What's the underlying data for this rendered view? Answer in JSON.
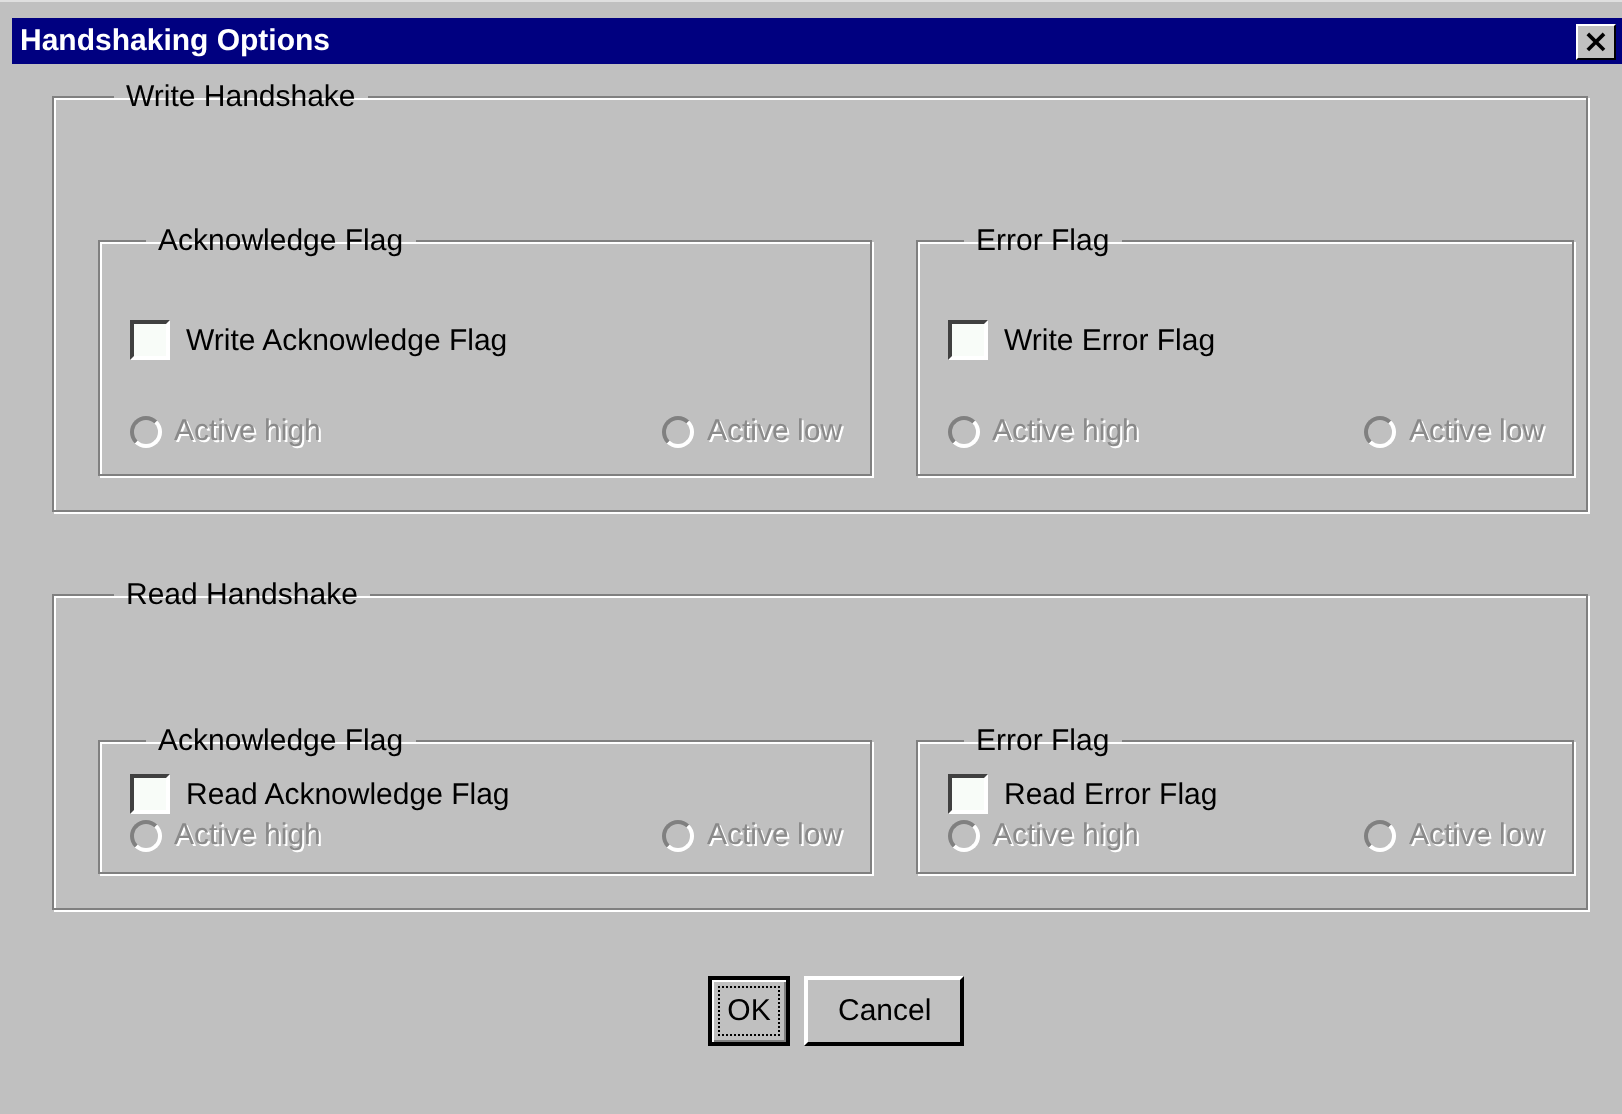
{
  "window": {
    "title": "Handshaking Options",
    "close": "×"
  },
  "groups": [
    {
      "title": "Write Handshake",
      "flags": [
        {
          "title": "Acknowledge Flag",
          "checkbox": {
            "label": "Write Acknowledge Flag",
            "checked": false
          },
          "radios": [
            {
              "label": "Active high",
              "selected": false,
              "disabled": true
            },
            {
              "label": "Active low",
              "selected": false,
              "disabled": true
            }
          ]
        },
        {
          "title": "Error Flag",
          "checkbox": {
            "label": "Write Error Flag",
            "checked": false
          },
          "radios": [
            {
              "label": "Active high",
              "selected": false,
              "disabled": true
            },
            {
              "label": "Active low",
              "selected": false,
              "disabled": true
            }
          ]
        }
      ]
    },
    {
      "title": "Read Handshake",
      "flags": [
        {
          "title": "Acknowledge Flag",
          "checkbox": {
            "label": "Read Acknowledge Flag",
            "checked": false
          },
          "radios": [
            {
              "label": "Active high",
              "selected": false,
              "disabled": true
            },
            {
              "label": "Active low",
              "selected": false,
              "disabled": true
            }
          ]
        },
        {
          "title": "Error Flag",
          "checkbox": {
            "label": "Read Error Flag",
            "checked": false
          },
          "radios": [
            {
              "label": "Active high",
              "selected": false,
              "disabled": true
            },
            {
              "label": "Active low",
              "selected": false,
              "disabled": true
            }
          ]
        }
      ]
    }
  ],
  "buttons": [
    {
      "label": "OK",
      "focused": true
    },
    {
      "label": "Cancel",
      "focused": false
    }
  ]
}
